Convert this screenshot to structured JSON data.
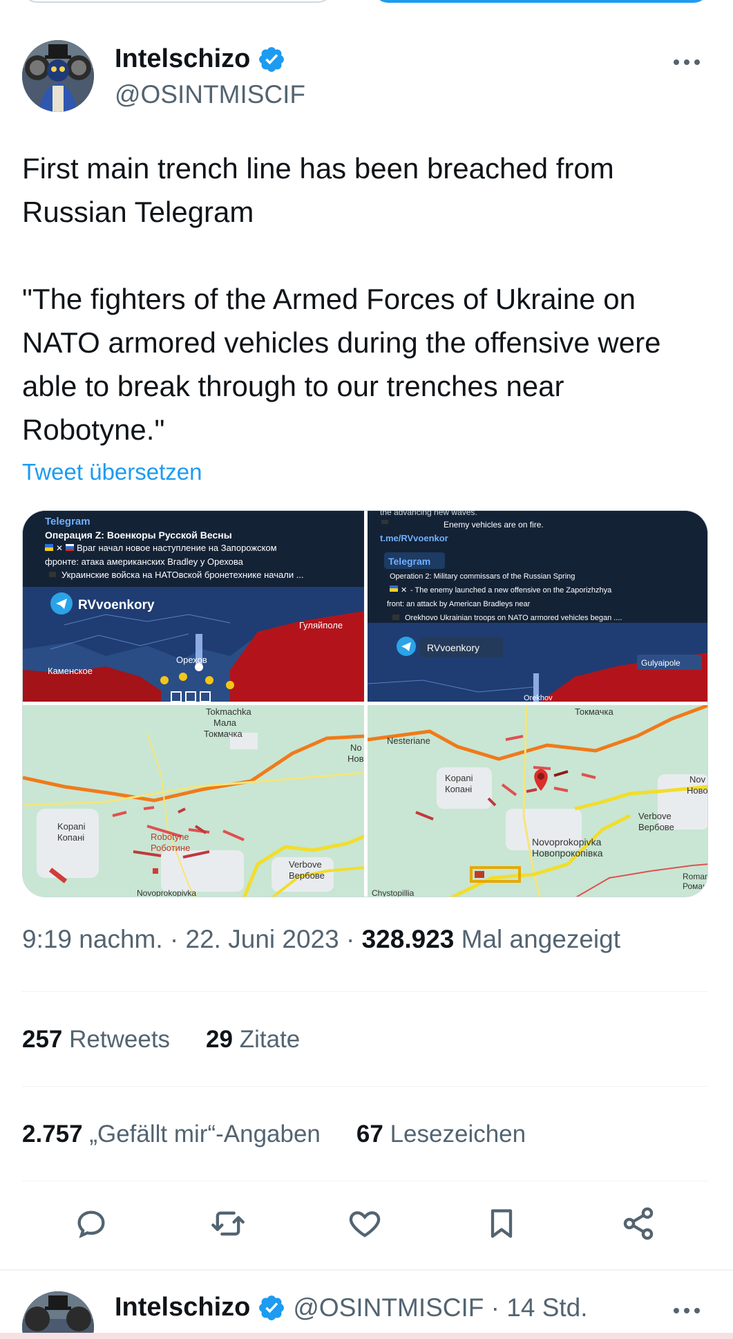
{
  "author": {
    "display_name": "Intelschizo",
    "handle": "@OSINTMISCIF"
  },
  "tweet": {
    "paragraph_1": "First main trench line has been breached from Russian Telegram",
    "paragraph_2": "\"The fighters of the Armed Forces of Ukraine on NATO armored vehicles during the offensive were able to break through to our trenches near Robotyne.\"",
    "translate_link": "Tweet übersetzen"
  },
  "media": {
    "tile1": {
      "source": "Telegram",
      "channel": "Операция Z: Военкоры Русской Весны",
      "line1": "Враг начал новое наступление на Запорожском",
      "line2": "фронте: атака американских Bradley у Орехова",
      "line3": "Украинские войска на НАТОвской бронетехнике начали ...",
      "watermark": "RVvoenkory",
      "place_a": "Гуляйполе",
      "place_b": "Каменское",
      "place_c": "Орехов"
    },
    "tile2": {
      "top_line": "the advancing new waves.",
      "fire_line": "Enemy vehicles are on fire.",
      "link": "t.me/RVvoenkor",
      "source": "Telegram",
      "channel": "Operation 2: Military commissars of the Russian Spring",
      "line1": "- The enemy launched a new offensive on the Zaporizhzhya",
      "line2": "front: an attack by American Bradleys near",
      "line3": "Orekhovo Ukrainian troops on NATO armored vehicles began ....",
      "watermark": "RVvoenkory",
      "place_a": "Gulyaipole",
      "place_b": "Orekhov"
    },
    "tile3": {
      "tokmachka_en": "Tokmachka",
      "tokmachka_ua": "Мала",
      "tokmachka_ru": "Токмачка",
      "kopani_en": "Kopani",
      "kopani_ru": "Копані",
      "robotyne_en": "Robotyne",
      "robotyne_ru": "Роботине",
      "verbove_en": "Verbove",
      "verbove_ru": "Вербове",
      "novoprok_en": "Novoprokopivka",
      "edge_1": "No",
      "edge_2": "Нов"
    },
    "tile4": {
      "tokmachka_ru": "Токмачка",
      "nesteriane": "Nesteriane",
      "kopani_en": "Kopani",
      "kopani_ru": "Копані",
      "verbove_en": "Verbove",
      "verbove_ru": "Вербове",
      "novoprok_en": "Novoprokopivka",
      "novoprok_ru": "Новопрокопівка",
      "chystopillia": "Chystopillia",
      "edge_1": "Nov",
      "edge_2": "Ново",
      "edge_3": "Roman",
      "edge_4": "Роман"
    }
  },
  "meta": {
    "time": "9:19 nachm.",
    "sep1": "·",
    "date": "22. Juni 2023",
    "sep2": "·",
    "views": "328.923",
    "views_label": "Mal angezeigt"
  },
  "stats_row1": {
    "retweets_count": "257",
    "retweets_label": "Retweets",
    "quotes_count": "29",
    "quotes_label": "Zitate"
  },
  "stats_row2": {
    "likes_count": "2.757",
    "likes_label": "„Gefällt mir“-Angaben",
    "bookmarks_count": "67",
    "bookmarks_label": "Lesezeichen"
  },
  "next_tweet": {
    "display_name": "Intelschizo",
    "handle_time": "@OSINTMISCIF · 14 Std."
  },
  "colors": {
    "accent": "#1d9bf0",
    "secondary_text": "#536471",
    "primary_text": "#0f1419"
  },
  "icons": [
    "reply-icon",
    "retweet-icon",
    "like-icon",
    "bookmark-icon",
    "share-icon",
    "verified-icon",
    "more-icon"
  ]
}
